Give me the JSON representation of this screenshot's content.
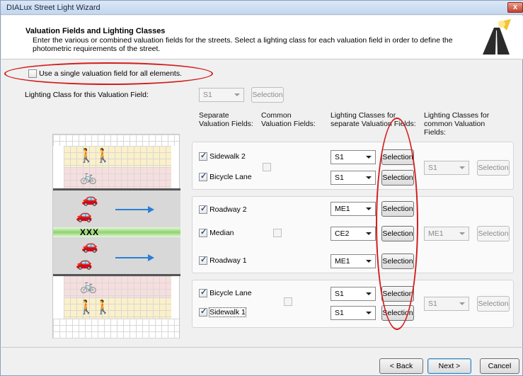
{
  "window": {
    "title": "DIALux Street Light Wizard",
    "close_glyph": "x"
  },
  "header": {
    "title": "Valuation Fields and Lighting Classes",
    "description": "Enter the various or combined valuation fields for the streets. Select a lighting class for each valuation field in order to define the photometric requirements of the street."
  },
  "single_field": {
    "label": "Use a single valuation field for all elements.",
    "checked": false
  },
  "lighting_class_row": {
    "label": "Lighting Class for this Valuation Field:",
    "value": "S1",
    "button": "Selection"
  },
  "columns": {
    "separate": "Separate Valuation Fields:",
    "common": "Common Valuation Fields:",
    "classes_separate": "Lighting Classes for separate Valuation Fields:",
    "classes_common": "Lighting Classes for common Valuation Fields:"
  },
  "groups": [
    {
      "rows": [
        {
          "label": "Sidewalk 2",
          "checked": true,
          "class": "S1",
          "button": "Selection"
        },
        {
          "label": "Bicycle Lane",
          "checked": true,
          "class": "S1",
          "button": "Selection"
        }
      ],
      "common_class": "S1",
      "common_button": "Selection"
    },
    {
      "rows": [
        {
          "label": "Roadway 2",
          "checked": true,
          "class": "ME1",
          "button": "Selection"
        },
        {
          "label": "Median",
          "checked": true,
          "class": "CE2",
          "button": "Selection"
        },
        {
          "label": "Roadway 1",
          "checked": true,
          "class": "ME1",
          "button": "Selection"
        }
      ],
      "common_class": "ME1",
      "common_button": "Selection"
    },
    {
      "rows": [
        {
          "label": "Bicycle Lane",
          "checked": true,
          "class": "S1",
          "button": "Selection"
        },
        {
          "label": "Sidewalk 1",
          "checked": true,
          "class": "S1",
          "button": "Selection"
        }
      ],
      "common_class": "S1",
      "common_button": "Selection"
    }
  ],
  "street": {
    "median_text": "XXX",
    "pedestrian_glyph": "🚶🚶",
    "bike_glyph": "🚲",
    "car_glyph": "🚗"
  },
  "footer": {
    "back": "< Back",
    "next": "Next >",
    "cancel": "Cancel"
  },
  "colors": {
    "annotation": "#d21d1d",
    "sidewalk": "#fbf0c8",
    "bicycle": "#f7dede",
    "roadway": "#d8d8d8",
    "median": "#bfe8a8",
    "arrow": "#2a7fd6"
  }
}
